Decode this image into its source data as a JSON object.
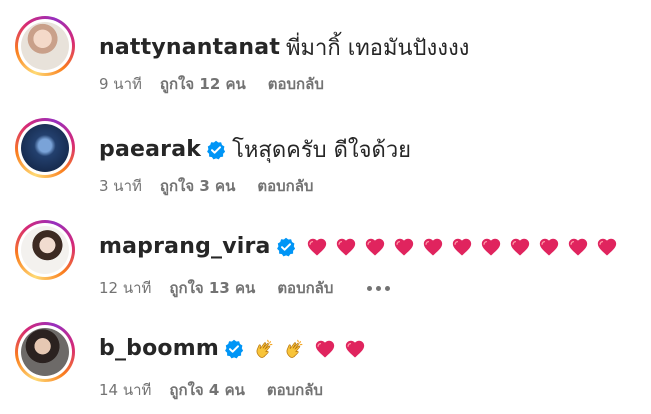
{
  "comments": [
    {
      "username": "nattynantanat",
      "verified": false,
      "text": "พี่มากิ้ เทอมันปังงงง",
      "time": "9 นาที",
      "likes": "ถูกใจ 12 คน",
      "reply": "ตอบกลับ",
      "emojis": []
    },
    {
      "username": "paearak",
      "verified": true,
      "text": "โหสุดครับ ดีใจด้วย",
      "time": "3 นาที",
      "likes": "ถูกใจ 3 คน",
      "reply": "ตอบกลับ",
      "emojis": []
    },
    {
      "username": "maprang_vira",
      "verified": true,
      "text": "",
      "time": "12 นาที",
      "likes": "ถูกใจ 13 คน",
      "reply": "ตอบกลับ",
      "emojis": [
        "heart",
        "heart",
        "heart",
        "heart",
        "heart",
        "heart",
        "heart",
        "heart",
        "heart",
        "heart",
        "heart"
      ],
      "more_menu": true
    },
    {
      "username": "b_boomm",
      "verified": true,
      "text": "",
      "time": "14 นาที",
      "likes": "ถูกใจ 4 คน",
      "reply": "ตอบกลับ",
      "emojis": [
        "clap",
        "clap",
        "heart",
        "heart"
      ]
    }
  ],
  "colors": {
    "verified": "#0095f6",
    "heart": "#e0245e",
    "secondary_text": "#737373",
    "primary_text": "#262626"
  },
  "icons": {
    "verified": "verified-badge-icon",
    "heart": "red-heart-emoji",
    "clap": "clapping-hands-emoji",
    "more": "more-options-icon"
  }
}
